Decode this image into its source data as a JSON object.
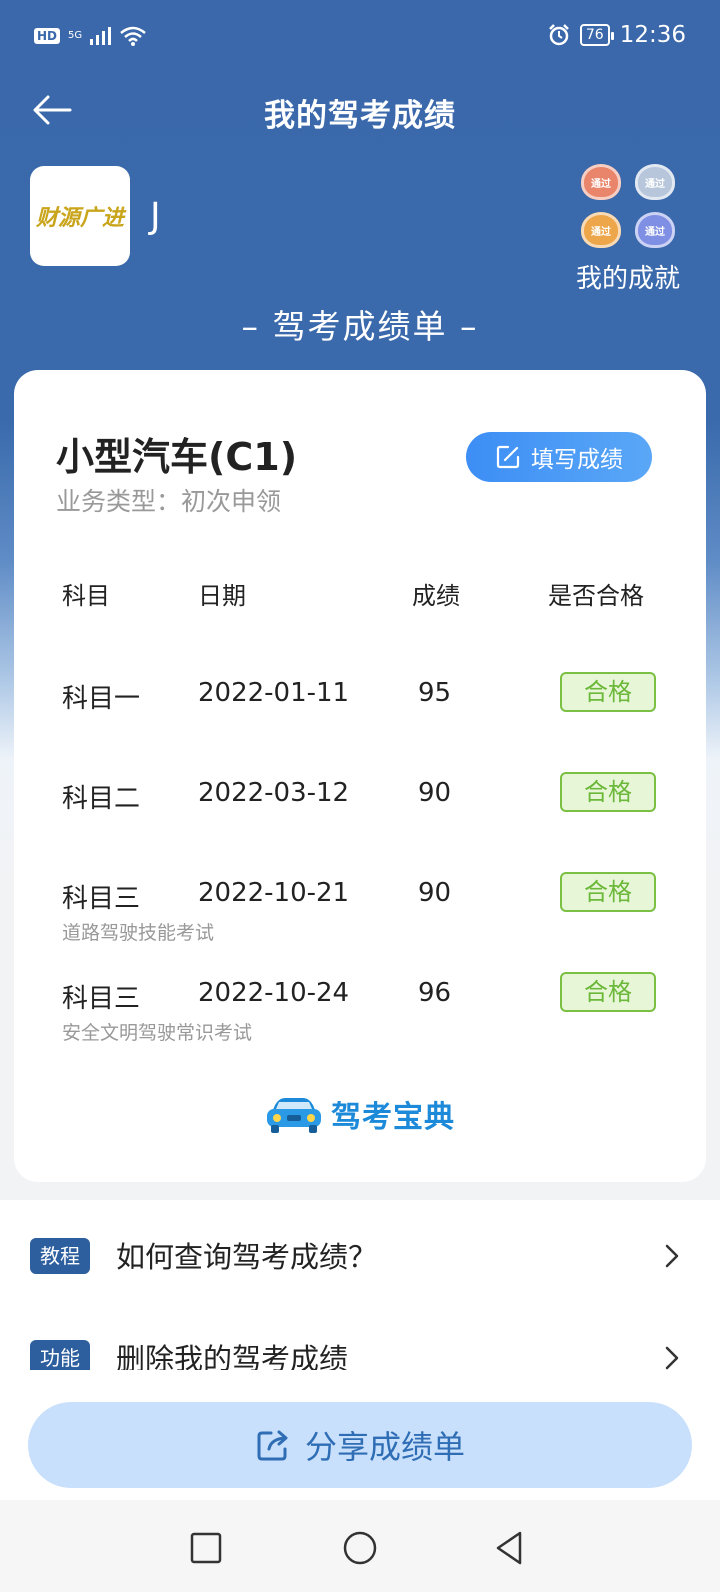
{
  "status_bar": {
    "left_label": "HD",
    "network": "5G",
    "battery": "76",
    "time": "12:36"
  },
  "header": {
    "title": "我的驾考成绩"
  },
  "profile": {
    "avatar_text": "财源广进",
    "username": "J"
  },
  "achievements": {
    "label": "我的成就",
    "medals": [
      {
        "icon": "bronze-medal-icon",
        "text": "通过",
        "color": "#e9856a"
      },
      {
        "icon": "silver-medal-icon",
        "text": "通过",
        "color": "#b7c6db"
      },
      {
        "icon": "gold-medal-icon",
        "text": "通过",
        "color": "#eda64a"
      },
      {
        "icon": "purple-medal-icon",
        "text": "通过",
        "color": "#7f8fe3"
      }
    ]
  },
  "section_title": "– 驾考成绩单 –",
  "card": {
    "vehicle": "小型汽车(C1)",
    "business_type": "业务类型：初次申领",
    "fill_button": "填写成绩",
    "columns": {
      "subject": "科目",
      "date": "日期",
      "score": "成绩",
      "passed": "是否合格"
    },
    "rows": [
      {
        "subject": "科目一",
        "date": "2022-01-11",
        "score": "95",
        "status": "合格",
        "sub": ""
      },
      {
        "subject": "科目二",
        "date": "2022-03-12",
        "score": "90",
        "status": "合格",
        "sub": ""
      },
      {
        "subject": "科目三",
        "date": "2022-10-21",
        "score": "90",
        "status": "合格",
        "sub": "道路驾驶技能考试"
      },
      {
        "subject": "科目三",
        "date": "2022-10-24",
        "score": "96",
        "status": "合格",
        "sub": "安全文明驾驶常识考试"
      }
    ],
    "brand": "驾考宝典"
  },
  "list": [
    {
      "tag": "教程",
      "text": "如何查询驾考成绩？"
    },
    {
      "tag": "功能",
      "text": "删除我的驾考成绩"
    }
  ],
  "share_button": "分享成绩单",
  "colors": {
    "primary": "#3a68ab",
    "accent": "#3d8ef5",
    "pass_green": "#6cb83a"
  }
}
